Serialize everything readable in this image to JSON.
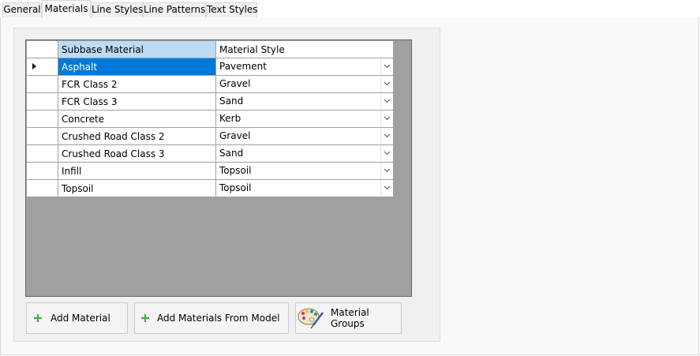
{
  "tabs": [
    {
      "label": "General",
      "active": false
    },
    {
      "label": "Materials",
      "active": true
    },
    {
      "label": "Line Styles",
      "active": false
    },
    {
      "label": "Line Patterns",
      "active": false
    },
    {
      "label": "Text Styles",
      "active": false
    }
  ],
  "grid": {
    "columns": [
      "Subbase Material",
      "Material Style"
    ],
    "rows": [
      {
        "material": "Asphalt",
        "style": "Pavement",
        "selected": true
      },
      {
        "material": "FCR Class 2",
        "style": "Gravel"
      },
      {
        "material": "FCR Class 3",
        "style": "Sand"
      },
      {
        "material": "Concrete",
        "style": "Kerb"
      },
      {
        "material": "Crushed Road Class 2",
        "style": "Gravel"
      },
      {
        "material": "Crushed Road Class 3",
        "style": "Sand"
      },
      {
        "material": "Infill",
        "style": "Topsoil"
      },
      {
        "material": "Topsoil",
        "style": "Topsoil"
      }
    ]
  },
  "buttons": {
    "add_material": "Add Material",
    "add_from_model": "Add Materials From Model",
    "material_groups": "Material Groups"
  },
  "icons": {
    "add": "plus-icon",
    "palette": "palette-icon",
    "dropdown": "chevron-down-icon",
    "row_pointer": "row-pointer-icon"
  },
  "colors": {
    "selection": "#0078d7",
    "header_selected": "#bcdcf4",
    "grid_background": "#a0a0a0",
    "plus_green": "#2e9b2e"
  }
}
